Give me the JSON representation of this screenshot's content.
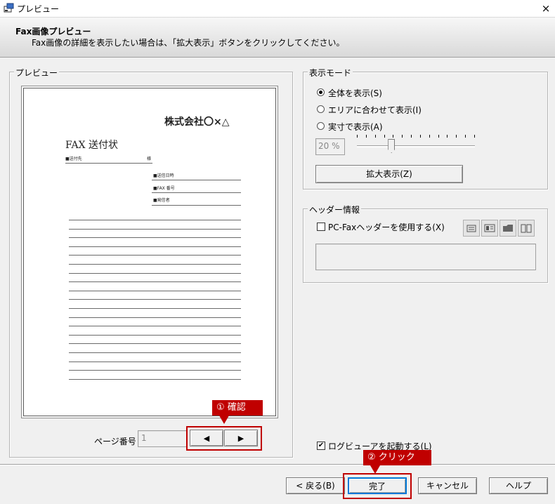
{
  "window": {
    "title": "プレビュー",
    "close_glyph": "×"
  },
  "header": {
    "title": "Fax画像プレビュー",
    "description": "Fax画像の詳細を表示したい場合は、「拡大表示」ボタンをクリックしてください。"
  },
  "preview": {
    "group_label": "プレビュー",
    "document": {
      "company": "株式会社〇×△",
      "doc_title": "FAX 送付状",
      "to_label": "■送付先",
      "honorific": "様",
      "date_label": "■送信日時",
      "fax_label": "■FAX 番号",
      "sender_label": "■発信者"
    },
    "page_number_label": "ページ番号",
    "page_number_value": "1",
    "prev_glyph": "◀",
    "next_glyph": "▶"
  },
  "display_mode": {
    "group_label": "表示モード",
    "options": [
      "全体を表示(S)",
      "エリアに合わせて表示(I)",
      "実寸で表示(A)"
    ],
    "selected": 0,
    "zoom_value": "20 %",
    "zoom_slider_fraction": 0.28,
    "zoom_button": "拡大表示(Z)"
  },
  "header_info": {
    "group_label": "ヘッダー情報",
    "use_pcfax_header": "PC-Faxヘッダーを使用する(X)",
    "icons": [
      "card-icon",
      "address-card-icon",
      "folder-icon",
      "book-icon"
    ]
  },
  "log_viewer_checkbox": {
    "label": "ログビューアを起動する(L)",
    "checked": true
  },
  "buttons": {
    "back": "< 戻る(B)",
    "finish": "完了",
    "cancel": "キャンセル",
    "help": "ヘルプ"
  },
  "annotations": {
    "step1": "① 確認",
    "step2": "② クリック"
  },
  "colors": {
    "accent_red": "#c00000"
  }
}
